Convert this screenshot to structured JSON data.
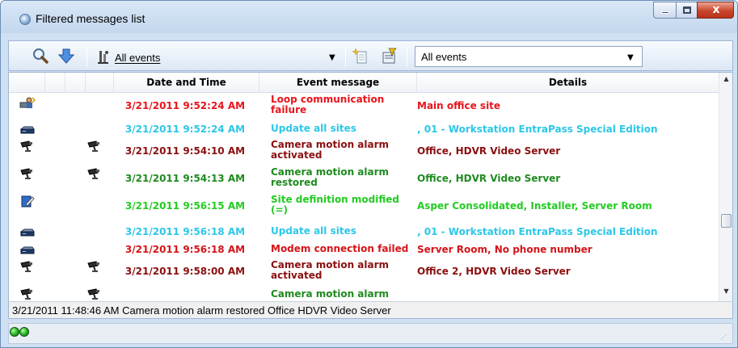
{
  "window": {
    "title": "Filtered messages list",
    "controls": {
      "close": "x"
    }
  },
  "toolbar": {
    "search_icon": "magnifier-icon",
    "down_icon": "blue-down-arrow-icon",
    "filter_icon": "event-filter-icon",
    "filter_label": "All events",
    "new_icon": "new-sparkle-icon",
    "filter_edit_icon": "filter-edit-icon",
    "events_select": {
      "value": "All events"
    }
  },
  "grid": {
    "columns": [
      "Date and Time",
      "Event message",
      "Details"
    ],
    "rows": [
      {
        "icon1": "workstation-user-icon",
        "icon2": "",
        "datetime": "3/21/2011 9:52:24 AM",
        "message": "Loop communication failure",
        "details": "Main office site",
        "color": "#e8141c"
      },
      {
        "icon1": "server-icon",
        "icon2": "",
        "datetime": "3/21/2011 9:52:24 AM",
        "message": "Update all sites",
        "details": ", 01 - Workstation EntraPass Special Edition",
        "color": "#2cc7e8"
      },
      {
        "icon1": "camera-icon",
        "icon2": "camera-icon",
        "datetime": "3/21/2011 9:54:10 AM",
        "message": "Camera motion alarm activated",
        "details": "Office, HDVR Video Server",
        "color": "#8b0f0f"
      },
      {
        "icon1": "camera-icon",
        "icon2": "camera-icon",
        "datetime": "3/21/2011 9:54:13 AM",
        "message": "Camera motion alarm restored",
        "details": "Office, HDVR Video Server",
        "color": "#1f8a1f"
      },
      {
        "icon1": "edit-icon",
        "icon2": "",
        "datetime": "3/21/2011 9:56:15 AM",
        "message": "Site definition modified (=)",
        "details": "Asper Consolidated, Installer, Server Room",
        "color": "#22cc22"
      },
      {
        "icon1": "server-icon",
        "icon2": "",
        "datetime": "3/21/2011 9:56:18 AM",
        "message": "Update all sites",
        "details": ", 01 - Workstation EntraPass Special Edition",
        "color": "#2cc7e8"
      },
      {
        "icon1": "server-icon",
        "icon2": "",
        "datetime": "3/21/2011 9:56:18 AM",
        "message": "Modem connection failed",
        "details": "Server Room, No phone number",
        "color": "#d41418"
      },
      {
        "icon1": "camera-icon",
        "icon2": "camera-icon",
        "datetime": "3/21/2011 9:58:00 AM",
        "message": "Camera motion alarm activated",
        "details": "Office 2, HDVR Video Server",
        "color": "#8b0f0f"
      },
      {
        "icon1": "camera-icon",
        "icon2": "camera-icon",
        "datetime": "",
        "message": "Camera motion alarm",
        "details": "",
        "color": "#1f8a1f"
      }
    ]
  },
  "status": {
    "text": "3/21/2011 11:48:46 AM  Camera motion alarm restored  Office  HDVR Video Server"
  },
  "bottom": {
    "indicators": [
      "green-led-icon",
      "green-led-icon"
    ]
  }
}
